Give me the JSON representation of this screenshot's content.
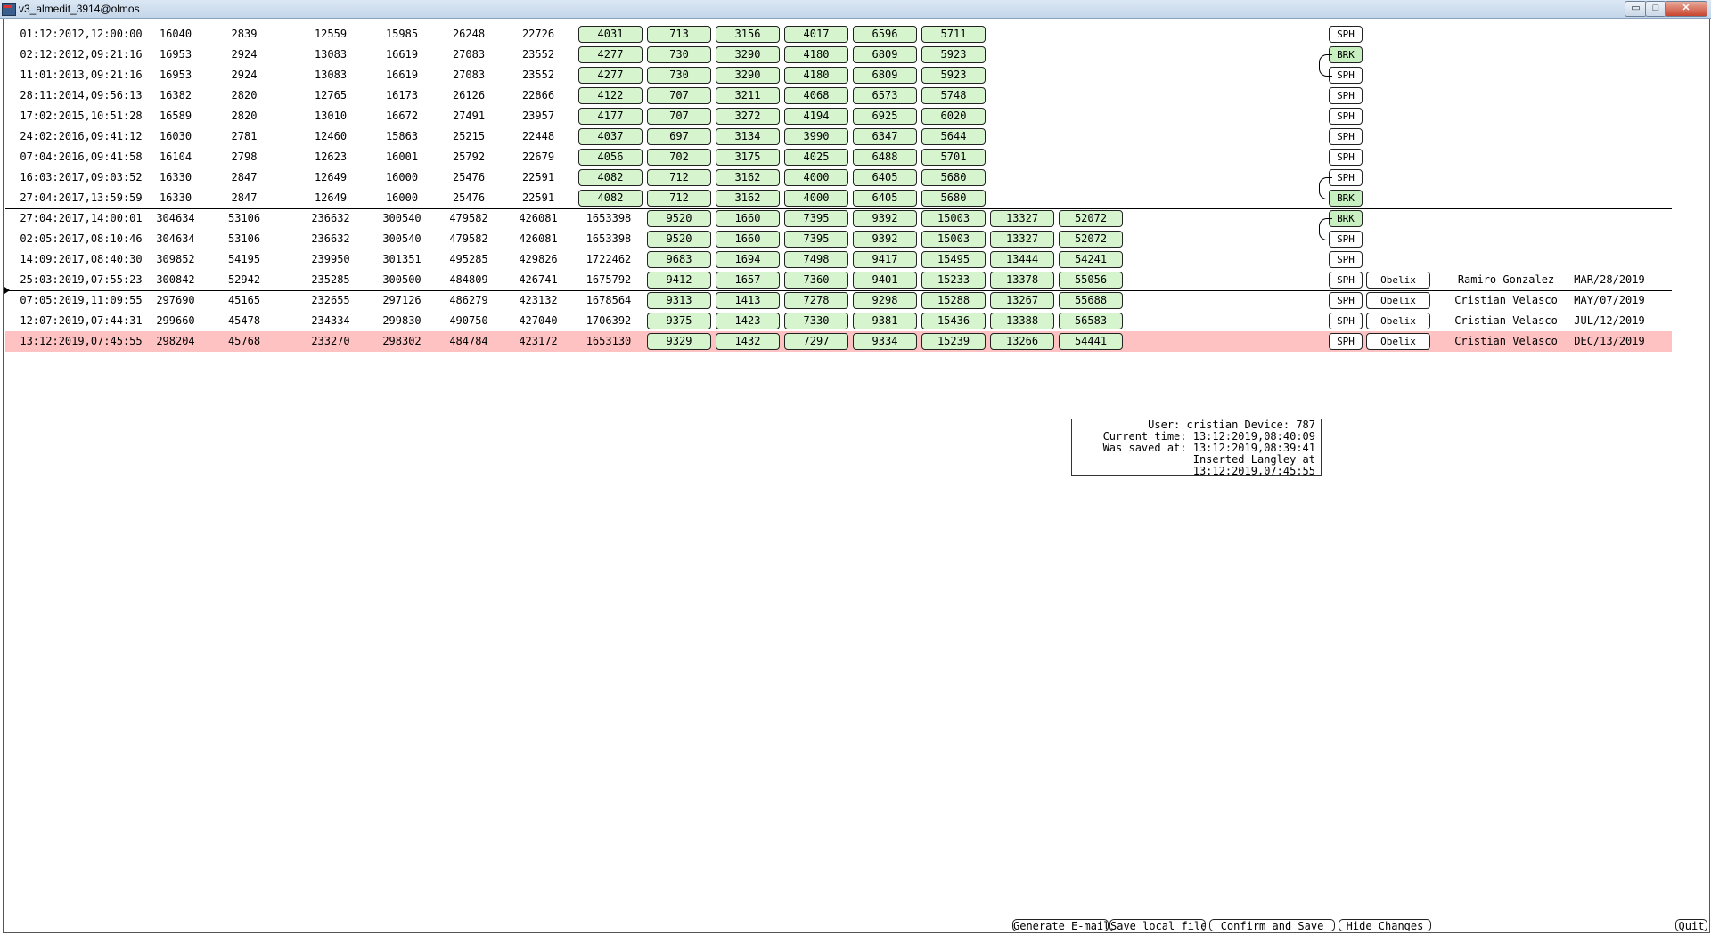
{
  "window": {
    "title": "v3_almedit_3914@olmos",
    "minimize": "▭",
    "maximize": "□",
    "close": "✕"
  },
  "rows": [
    {
      "date": "01:12:2012,12:00:00",
      "v": [
        "16040",
        "2839",
        "12559",
        "15985",
        "26248",
        "22726"
      ],
      "pills": [
        "4031",
        "713",
        "3156",
        "4017",
        "6596",
        "5711"
      ],
      "tag": "SPH"
    },
    {
      "date": "02:12:2012,09:21:16",
      "v": [
        "16953",
        "2924",
        "13083",
        "16619",
        "27083",
        "23552"
      ],
      "pills": [
        "4277",
        "730",
        "3290",
        "4180",
        "6809",
        "5923"
      ],
      "tag": "BRK"
    },
    {
      "date": "11:01:2013,09:21:16",
      "v": [
        "16953",
        "2924",
        "13083",
        "16619",
        "27083",
        "23552"
      ],
      "pills": [
        "4277",
        "730",
        "3290",
        "4180",
        "6809",
        "5923"
      ],
      "tag": "SPH"
    },
    {
      "date": "28:11:2014,09:56:13",
      "v": [
        "16382",
        "2820",
        "12765",
        "16173",
        "26126",
        "22866"
      ],
      "pills": [
        "4122",
        "707",
        "3211",
        "4068",
        "6573",
        "5748"
      ],
      "tag": "SPH"
    },
    {
      "date": "17:02:2015,10:51:28",
      "v": [
        "16589",
        "2820",
        "13010",
        "16672",
        "27491",
        "23957"
      ],
      "pills": [
        "4177",
        "707",
        "3272",
        "4194",
        "6925",
        "6020"
      ],
      "tag": "SPH"
    },
    {
      "date": "24:02:2016,09:41:12",
      "v": [
        "16030",
        "2781",
        "12460",
        "15863",
        "25215",
        "22448"
      ],
      "pills": [
        "4037",
        "697",
        "3134",
        "3990",
        "6347",
        "5644"
      ],
      "tag": "SPH"
    },
    {
      "date": "07:04:2016,09:41:58",
      "v": [
        "16104",
        "2798",
        "12623",
        "16001",
        "25792",
        "22679"
      ],
      "pills": [
        "4056",
        "702",
        "3175",
        "4025",
        "6488",
        "5701"
      ],
      "tag": "SPH"
    },
    {
      "date": "16:03:2017,09:03:52",
      "v": [
        "16330",
        "2847",
        "12649",
        "16000",
        "25476",
        "22591"
      ],
      "pills": [
        "4082",
        "712",
        "3162",
        "4000",
        "6405",
        "5680"
      ],
      "tag": "SPH"
    },
    {
      "date": "27:04:2017,13:59:59",
      "v": [
        "16330",
        "2847",
        "12649",
        "16000",
        "25476",
        "22591"
      ],
      "pills": [
        "4082",
        "712",
        "3162",
        "4000",
        "6405",
        "5680"
      ],
      "tag": "BRK"
    },
    {
      "date": "27:04:2017,14:00:01",
      "v": [
        "304634",
        "53106",
        "236632",
        "300540",
        "479582",
        "426081",
        "1653398"
      ],
      "pills": [
        "9520",
        "1660",
        "7395",
        "9392",
        "15003",
        "13327",
        "52072"
      ],
      "tag": "BRK"
    },
    {
      "date": "02:05:2017,08:10:46",
      "v": [
        "304634",
        "53106",
        "236632",
        "300540",
        "479582",
        "426081",
        "1653398"
      ],
      "pills": [
        "9520",
        "1660",
        "7395",
        "9392",
        "15003",
        "13327",
        "52072"
      ],
      "tag": "SPH"
    },
    {
      "date": "14:09:2017,08:40:30",
      "v": [
        "309852",
        "54195",
        "239950",
        "301351",
        "495285",
        "429826",
        "1722462"
      ],
      "pills": [
        "9683",
        "1694",
        "7498",
        "9417",
        "15495",
        "13444",
        "54241"
      ],
      "tag": "SPH"
    },
    {
      "date": "25:03:2019,07:55:23",
      "v": [
        "300842",
        "52942",
        "235285",
        "300500",
        "484809",
        "426741",
        "1675792"
      ],
      "pills": [
        "9412",
        "1657",
        "7360",
        "9401",
        "15233",
        "13378",
        "55056"
      ],
      "tag": "SPH",
      "obelix": "Obelix",
      "user": "Ramiro Gonzalez",
      "when": "MAR/28/2019"
    },
    {
      "date": "07:05:2019,11:09:55",
      "v": [
        "297690",
        "45165",
        "232655",
        "297126",
        "486279",
        "423132",
        "1678564"
      ],
      "pills": [
        "9313",
        "1413",
        "7278",
        "9298",
        "15288",
        "13267",
        "55688"
      ],
      "tag": "SPH",
      "obelix": "Obelix",
      "user": "Cristian Velasco",
      "when": "MAY/07/2019"
    },
    {
      "date": "12:07:2019,07:44:31",
      "v": [
        "299660",
        "45478",
        "234334",
        "299830",
        "490750",
        "427040",
        "1706392"
      ],
      "pills": [
        "9375",
        "1423",
        "7330",
        "9381",
        "15436",
        "13388",
        "56583"
      ],
      "tag": "SPH",
      "obelix": "Obelix",
      "user": "Cristian Velasco",
      "when": "JUL/12/2019"
    },
    {
      "date": "13:12:2019,07:45:55",
      "v": [
        "298204",
        "45768",
        "233270",
        "298302",
        "484784",
        "423172",
        "1653130"
      ],
      "pills": [
        "9329",
        "1432",
        "7297",
        "9334",
        "15239",
        "13266",
        "54441"
      ],
      "tag": "SPH",
      "obelix": "Obelix",
      "user": "Cristian Velasco",
      "when": "DEC/13/2019",
      "highlight": true
    }
  ],
  "info": {
    "user_line": "User: cristian Device: 787",
    "current_time": "Current time: 13:12:2019,08:40:09",
    "saved_at": "Was saved at: 13:12:2019,08:39:41",
    "inserted": "Inserted Langley at 13:12:2019,07:45:55"
  },
  "buttons": {
    "generate_email": "Generate E-mail",
    "save_local": "Save local file",
    "confirm_save": "Confirm and Save",
    "hide_changes": "Hide Changes",
    "quit": "Quit"
  },
  "colors": {
    "highlight_row": "#ffc2c2",
    "pill_fill": "#d6f5cf",
    "brk_fill": "#c7efc0"
  }
}
